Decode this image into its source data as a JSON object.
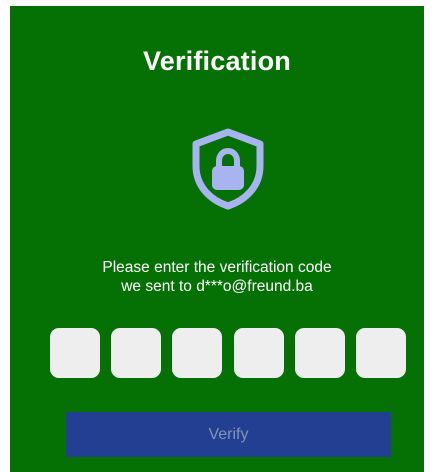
{
  "screen": {
    "title": "Verification",
    "icon": "shield-lock-icon",
    "message_line1": "Please enter the verification code",
    "message_line2": "we sent to d***o@freund.ba",
    "code_digits": [
      "",
      "",
      "",
      "",
      "",
      ""
    ],
    "verify_label": "Verify"
  },
  "colors": {
    "background": "#057105",
    "shield": "#a8b4f0",
    "code_box": "#eeeeee",
    "button_bg": "#223f91",
    "button_text": "#8593b6"
  }
}
